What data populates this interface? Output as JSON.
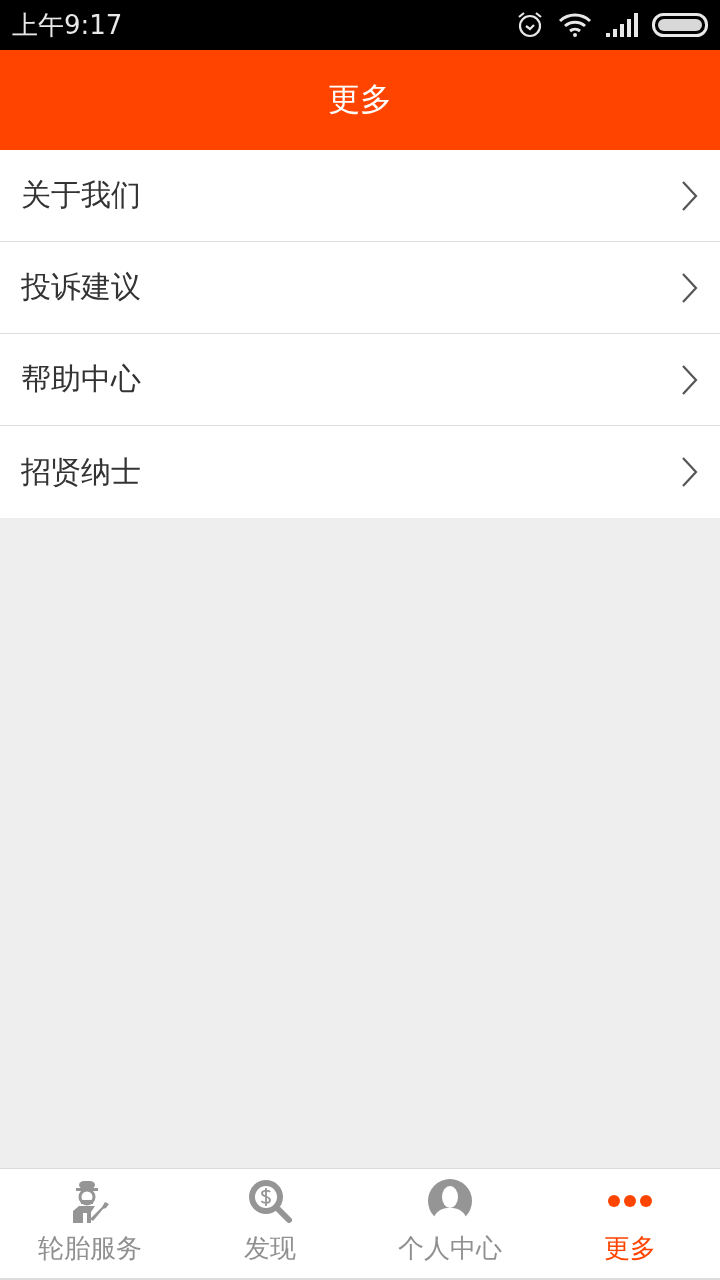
{
  "status_bar": {
    "time": "上午9:17"
  },
  "header": {
    "title": "更多"
  },
  "menu": [
    {
      "label": "关于我们"
    },
    {
      "label": "投诉建议"
    },
    {
      "label": "帮助中心"
    },
    {
      "label": "招贤纳士"
    }
  ],
  "tab_bar": [
    {
      "label": "轮胎服务",
      "selected": false
    },
    {
      "label": "发现",
      "selected": false
    },
    {
      "label": "个人中心",
      "selected": false
    },
    {
      "label": "更多",
      "selected": true
    }
  ]
}
